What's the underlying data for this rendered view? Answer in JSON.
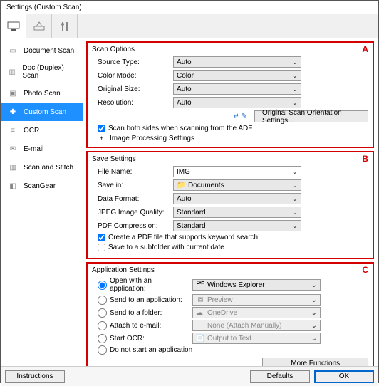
{
  "window": {
    "title": "Settings (Custom Scan)"
  },
  "sidebar": {
    "items": [
      {
        "label": "Document Scan"
      },
      {
        "label": "Doc (Duplex) Scan"
      },
      {
        "label": "Photo Scan"
      },
      {
        "label": "Custom Scan"
      },
      {
        "label": "OCR"
      },
      {
        "label": "E-mail"
      },
      {
        "label": "Scan and Stitch"
      },
      {
        "label": "ScanGear"
      }
    ]
  },
  "groupA": {
    "tag": "A",
    "title": "Scan Options",
    "source_label": "Source Type:",
    "source_value": "Auto",
    "colormode_label": "Color Mode:",
    "colormode_value": "Color",
    "origsize_label": "Original Size:",
    "origsize_value": "Auto",
    "resolution_label": "Resolution:",
    "resolution_value": "Auto",
    "orient_btn": "Original Scan Orientation Settings...",
    "adf_label": "Scan both sides when scanning from the ADF",
    "imgproc_label": "Image Processing Settings"
  },
  "groupB": {
    "tag": "B",
    "title": "Save Settings",
    "filename_label": "File Name:",
    "filename_value": "IMG",
    "savein_label": "Save in:",
    "savein_value": "Documents",
    "dataformat_label": "Data Format:",
    "dataformat_value": "Auto",
    "jpeg_label": "JPEG Image Quality:",
    "jpeg_value": "Standard",
    "pdfc_label": "PDF Compression:",
    "pdfc_value": "Standard",
    "pdfkw_label": "Create a PDF file that supports keyword search",
    "subf_label": "Save to a subfolder with current date"
  },
  "groupC": {
    "tag": "C",
    "title": "Application Settings",
    "r1_label": "Open with an application:",
    "r1_value": "Windows Explorer",
    "r2_label": "Send to an application:",
    "r2_value": "Preview",
    "r3_label": "Send to a folder:",
    "r3_value": "OneDrive",
    "r4_label": "Attach to e-mail:",
    "r4_value": "None (Attach Manually)",
    "r5_label": "Start OCR:",
    "r5_value": "Output to Text",
    "r6_label": "Do not start an application",
    "more_btn": "More Functions"
  },
  "footer": {
    "instructions": "Instructions",
    "defaults": "Defaults",
    "ok": "OK"
  }
}
